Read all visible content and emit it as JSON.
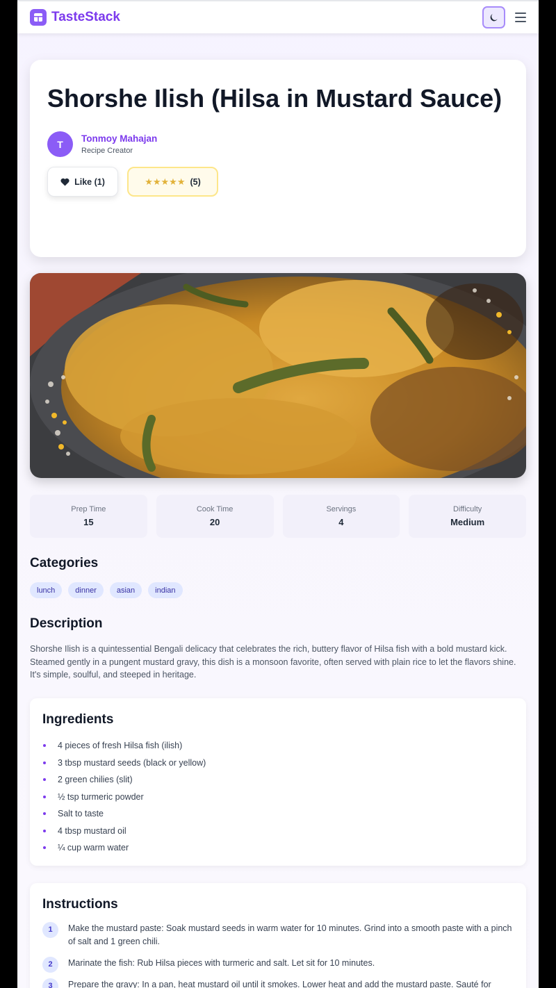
{
  "app": {
    "brand_name": "TasteStack",
    "accent_color": "#8b5cf6",
    "theme_toggle_icon": "moon-icon",
    "menu_icon": "hamburger-menu-icon"
  },
  "recipe": {
    "title": "Shorshe Ilish (Hilsa in Mustard Sauce)",
    "author": {
      "initial": "T",
      "name": "Tonmoy Mahajan",
      "role": "Recipe Creator"
    },
    "like_label": "Like (1)",
    "rating_stars": "★★★★★",
    "rating_count": "(5)",
    "image_alt": "Shorshe Ilish dish photo"
  },
  "stats": [
    {
      "label": "Prep Time",
      "value": "15"
    },
    {
      "label": "Cook Time",
      "value": "20"
    },
    {
      "label": "Servings",
      "value": "4"
    },
    {
      "label": "Difficulty",
      "value": "Medium"
    }
  ],
  "categories": {
    "title": "Categories",
    "tags": [
      "lunch",
      "dinner",
      "asian",
      "indian"
    ]
  },
  "description": {
    "title": "Description",
    "text": "Shorshe Ilish is a quintessential Bengali delicacy that celebrates the rich, buttery flavor of Hilsa fish with a bold mustard kick. Steamed gently in a pungent mustard gravy, this dish is a monsoon favorite, often served with plain rice to let the flavors shine. It's simple, soulful, and steeped in heritage."
  },
  "ingredients": {
    "title": "Ingredients",
    "items": [
      "4 pieces of fresh Hilsa fish (ilish)",
      "3 tbsp mustard seeds (black or yellow)",
      "2 green chilies (slit)",
      "½ tsp turmeric powder",
      "Salt to taste",
      "4 tbsp mustard oil",
      "¼ cup warm water"
    ]
  },
  "instructions": {
    "title": "Instructions",
    "steps": [
      {
        "num": "1",
        "text": "Make the mustard paste: Soak mustard seeds in warm water for 10 minutes. Grind into a smooth paste with a pinch of salt and 1 green chili."
      },
      {
        "num": "2",
        "text": "Marinate the fish: Rub Hilsa pieces with turmeric and salt. Let sit for 10 minutes."
      },
      {
        "num": "3",
        "text": "Prepare the gravy: In a pan, heat mustard oil until it smokes. Lower heat and add the mustard paste. Sauté for"
      }
    ]
  }
}
